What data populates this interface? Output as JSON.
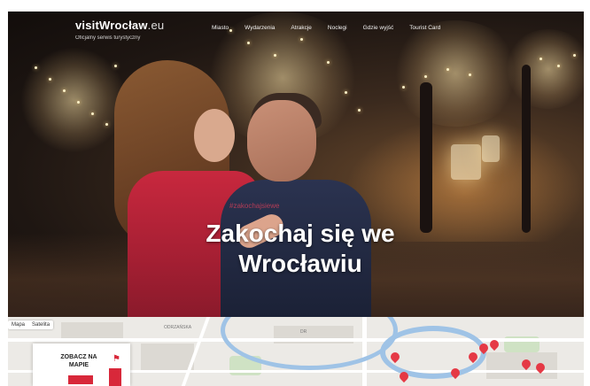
{
  "header": {
    "logo_main": "visitWrocław",
    "logo_tld": ".eu",
    "logo_sub": "Oficjalny serwis turystyczny",
    "nav": [
      "Miasto",
      "Wydarzenia",
      "Atrakcje",
      "Noclegi",
      "Gdzie wyjść",
      "Tourist Card"
    ]
  },
  "hero": {
    "tagline": "#zakochajsiewe",
    "headline": "Zakochaj się we Wrocławiu"
  },
  "map": {
    "type_buttons": [
      "Mapa",
      "Satelita"
    ],
    "street_labels": [
      "ODRZAŃSKA",
      "DR"
    ],
    "card_title": "ZOBACZ NA MAPIE"
  },
  "colors": {
    "accent": "#d8283a",
    "map_bg": "#eceae6",
    "river": "#9fc3e6"
  }
}
